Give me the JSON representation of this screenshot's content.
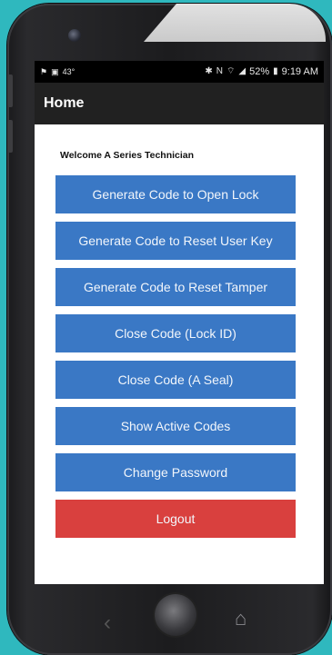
{
  "statusbar": {
    "left_icons": [
      "notification-icon",
      "image-icon"
    ],
    "temp": "43°",
    "battery": "52%",
    "time": "9:19 AM"
  },
  "appbar": {
    "title": "Home"
  },
  "welcome": "Welcome A Series Technician",
  "buttons": [
    {
      "label": "Generate Code to Open Lock"
    },
    {
      "label": "Generate Code to Reset User Key"
    },
    {
      "label": "Generate Code to Reset Tamper"
    },
    {
      "label": "Close Code (Lock ID)"
    },
    {
      "label": "Close Code (A Seal)"
    },
    {
      "label": "Show Active Codes"
    },
    {
      "label": "Change Password"
    }
  ],
  "logout": {
    "label": "Logout"
  },
  "colors": {
    "primary": "#3a78c5",
    "danger": "#d9403e",
    "appbar": "#212121",
    "background": "#2fb8be"
  }
}
